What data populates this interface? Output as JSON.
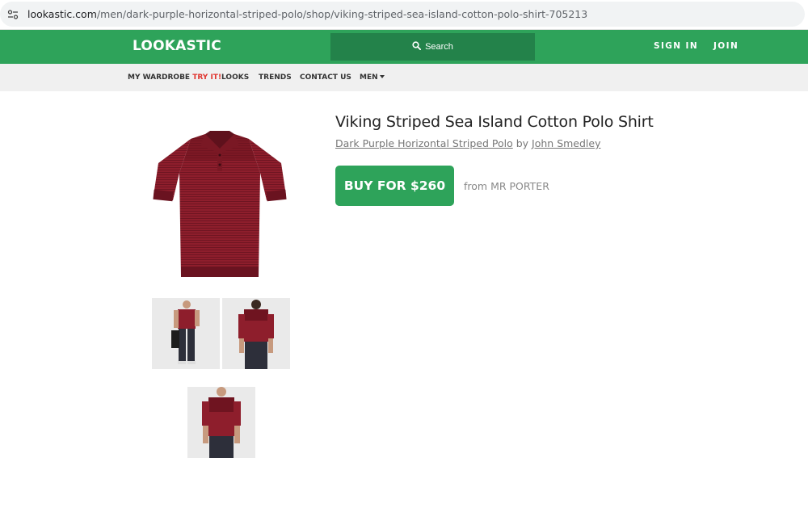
{
  "browser": {
    "url_host": "lookastic.com",
    "url_path": "/men/dark-purple-horizontal-striped-polo/shop/viking-striped-sea-island-cotton-polo-shirt-705213",
    "site_info_icon": "tune-icon"
  },
  "header": {
    "logo": "LOOKASTIC",
    "search_label": "Search",
    "search_icon": "search-icon",
    "sign_in": "SIGN IN",
    "join": "JOIN",
    "brand_color": "#2ea35a",
    "search_bg": "#23824a"
  },
  "subnav": {
    "wardrobe_label": "MY WARDROBE",
    "wardrobe_badge": "TRY IT!",
    "looks": "LOOKS",
    "trends": "TRENDS",
    "contact": "CONTACT US",
    "men": "MEN",
    "badge_color": "#e0352f"
  },
  "product": {
    "title": "Viking Striped Sea Island Cotton Polo Shirt",
    "category_link": "Dark Purple Horizontal Striped Polo",
    "by_word": "by",
    "brand_link": "John Smedley",
    "buy_label": "BUY FOR $260",
    "retailer": "from MR PORTER",
    "shirt_color": "#8e1e2c"
  }
}
